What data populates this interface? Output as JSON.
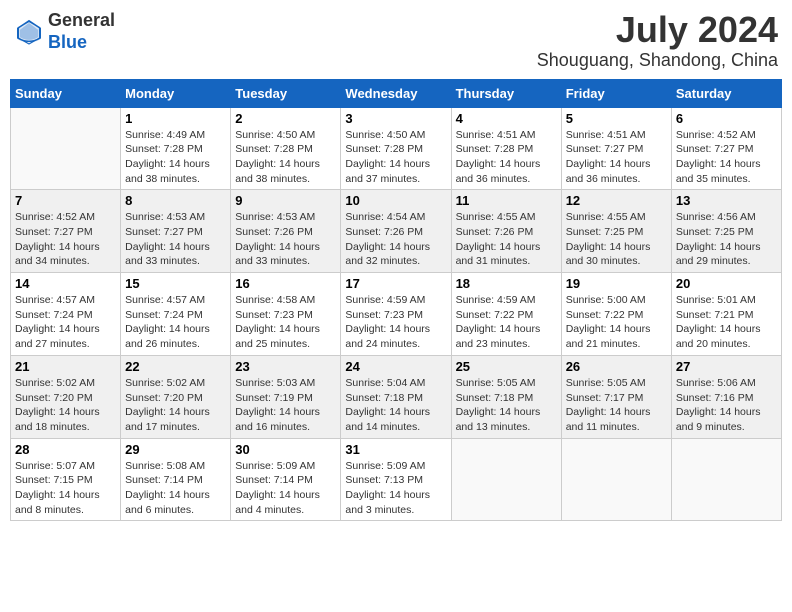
{
  "header": {
    "logo_line1": "General",
    "logo_line2": "Blue",
    "month_year": "July 2024",
    "location": "Shouguang, Shandong, China"
  },
  "days_of_week": [
    "Sunday",
    "Monday",
    "Tuesday",
    "Wednesday",
    "Thursday",
    "Friday",
    "Saturday"
  ],
  "weeks": [
    [
      {
        "day": "",
        "info": ""
      },
      {
        "day": "1",
        "info": "Sunrise: 4:49 AM\nSunset: 7:28 PM\nDaylight: 14 hours\nand 38 minutes."
      },
      {
        "day": "2",
        "info": "Sunrise: 4:50 AM\nSunset: 7:28 PM\nDaylight: 14 hours\nand 38 minutes."
      },
      {
        "day": "3",
        "info": "Sunrise: 4:50 AM\nSunset: 7:28 PM\nDaylight: 14 hours\nand 37 minutes."
      },
      {
        "day": "4",
        "info": "Sunrise: 4:51 AM\nSunset: 7:28 PM\nDaylight: 14 hours\nand 36 minutes."
      },
      {
        "day": "5",
        "info": "Sunrise: 4:51 AM\nSunset: 7:27 PM\nDaylight: 14 hours\nand 36 minutes."
      },
      {
        "day": "6",
        "info": "Sunrise: 4:52 AM\nSunset: 7:27 PM\nDaylight: 14 hours\nand 35 minutes."
      }
    ],
    [
      {
        "day": "7",
        "info": "Sunrise: 4:52 AM\nSunset: 7:27 PM\nDaylight: 14 hours\nand 34 minutes."
      },
      {
        "day": "8",
        "info": "Sunrise: 4:53 AM\nSunset: 7:27 PM\nDaylight: 14 hours\nand 33 minutes."
      },
      {
        "day": "9",
        "info": "Sunrise: 4:53 AM\nSunset: 7:26 PM\nDaylight: 14 hours\nand 33 minutes."
      },
      {
        "day": "10",
        "info": "Sunrise: 4:54 AM\nSunset: 7:26 PM\nDaylight: 14 hours\nand 32 minutes."
      },
      {
        "day": "11",
        "info": "Sunrise: 4:55 AM\nSunset: 7:26 PM\nDaylight: 14 hours\nand 31 minutes."
      },
      {
        "day": "12",
        "info": "Sunrise: 4:55 AM\nSunset: 7:25 PM\nDaylight: 14 hours\nand 30 minutes."
      },
      {
        "day": "13",
        "info": "Sunrise: 4:56 AM\nSunset: 7:25 PM\nDaylight: 14 hours\nand 29 minutes."
      }
    ],
    [
      {
        "day": "14",
        "info": "Sunrise: 4:57 AM\nSunset: 7:24 PM\nDaylight: 14 hours\nand 27 minutes."
      },
      {
        "day": "15",
        "info": "Sunrise: 4:57 AM\nSunset: 7:24 PM\nDaylight: 14 hours\nand 26 minutes."
      },
      {
        "day": "16",
        "info": "Sunrise: 4:58 AM\nSunset: 7:23 PM\nDaylight: 14 hours\nand 25 minutes."
      },
      {
        "day": "17",
        "info": "Sunrise: 4:59 AM\nSunset: 7:23 PM\nDaylight: 14 hours\nand 24 minutes."
      },
      {
        "day": "18",
        "info": "Sunrise: 4:59 AM\nSunset: 7:22 PM\nDaylight: 14 hours\nand 23 minutes."
      },
      {
        "day": "19",
        "info": "Sunrise: 5:00 AM\nSunset: 7:22 PM\nDaylight: 14 hours\nand 21 minutes."
      },
      {
        "day": "20",
        "info": "Sunrise: 5:01 AM\nSunset: 7:21 PM\nDaylight: 14 hours\nand 20 minutes."
      }
    ],
    [
      {
        "day": "21",
        "info": "Sunrise: 5:02 AM\nSunset: 7:20 PM\nDaylight: 14 hours\nand 18 minutes."
      },
      {
        "day": "22",
        "info": "Sunrise: 5:02 AM\nSunset: 7:20 PM\nDaylight: 14 hours\nand 17 minutes."
      },
      {
        "day": "23",
        "info": "Sunrise: 5:03 AM\nSunset: 7:19 PM\nDaylight: 14 hours\nand 16 minutes."
      },
      {
        "day": "24",
        "info": "Sunrise: 5:04 AM\nSunset: 7:18 PM\nDaylight: 14 hours\nand 14 minutes."
      },
      {
        "day": "25",
        "info": "Sunrise: 5:05 AM\nSunset: 7:18 PM\nDaylight: 14 hours\nand 13 minutes."
      },
      {
        "day": "26",
        "info": "Sunrise: 5:05 AM\nSunset: 7:17 PM\nDaylight: 14 hours\nand 11 minutes."
      },
      {
        "day": "27",
        "info": "Sunrise: 5:06 AM\nSunset: 7:16 PM\nDaylight: 14 hours\nand 9 minutes."
      }
    ],
    [
      {
        "day": "28",
        "info": "Sunrise: 5:07 AM\nSunset: 7:15 PM\nDaylight: 14 hours\nand 8 minutes."
      },
      {
        "day": "29",
        "info": "Sunrise: 5:08 AM\nSunset: 7:14 PM\nDaylight: 14 hours\nand 6 minutes."
      },
      {
        "day": "30",
        "info": "Sunrise: 5:09 AM\nSunset: 7:14 PM\nDaylight: 14 hours\nand 4 minutes."
      },
      {
        "day": "31",
        "info": "Sunrise: 5:09 AM\nSunset: 7:13 PM\nDaylight: 14 hours\nand 3 minutes."
      },
      {
        "day": "",
        "info": ""
      },
      {
        "day": "",
        "info": ""
      },
      {
        "day": "",
        "info": ""
      }
    ]
  ]
}
